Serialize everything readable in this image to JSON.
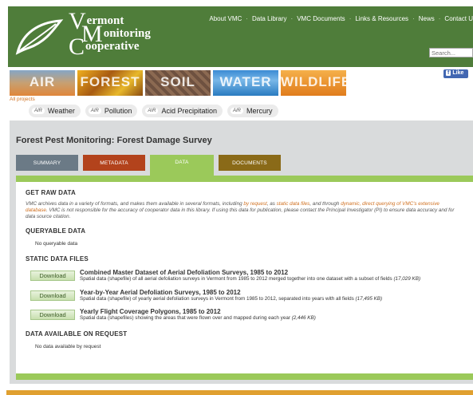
{
  "header": {
    "logo": {
      "line1": "ermont",
      "line2": "onitoring",
      "line3": "ooperative",
      "initial1": "V",
      "initial2": "M",
      "initial3": "C"
    },
    "nav": [
      {
        "label": "About VMC"
      },
      {
        "label": "Data Library"
      },
      {
        "label": "VMC Documents"
      },
      {
        "label": "Links & Resources"
      },
      {
        "label": "News"
      },
      {
        "label": "Contact U"
      }
    ],
    "nav_separator": "·",
    "search_placeholder": "Search..."
  },
  "topics": [
    {
      "label": "AIR"
    },
    {
      "label": "FOREST"
    },
    {
      "label": "SOIL"
    },
    {
      "label": "WATER"
    },
    {
      "label": "WILDLIFE"
    }
  ],
  "all_projects": "All projects",
  "facebook": {
    "f": "f",
    "label": "Like"
  },
  "subtabs": [
    {
      "badge": "AIR",
      "label": "Weather"
    },
    {
      "badge": "AIR",
      "label": "Pollution"
    },
    {
      "badge": "AIR",
      "label": "Acid Precipitation"
    },
    {
      "badge": "AIR",
      "label": "Mercury"
    }
  ],
  "page": {
    "title": "Forest Pest Monitoring: Forest Damage Survey",
    "tabs": {
      "summary": "SUMMARY",
      "metadata": "METADATA",
      "data": "DATA",
      "documents": "DOCUMENTS"
    }
  },
  "raw_data": {
    "heading": "GET RAW DATA",
    "intro_a": "VMC archives data in a variety of formats, and makes them available in several formats, including ",
    "link_request": "by request",
    "intro_b": ", as ",
    "link_static": "static data files",
    "intro_c": ", and through ",
    "link_dynamic": "dynamic, direct querying of VMC's extensive database",
    "intro_d": ". VMC is not responsible for the accuracy of cooperator data in this library. If using this data for publication, please contact the Principal Investigator (PI) to ensure data accuracy and for data source citation."
  },
  "queryable": {
    "heading": "QUERYABLE DATA",
    "text": "No queryable data"
  },
  "static_files": {
    "heading": "STATIC DATA FILES",
    "button_label": "Download",
    "files": [
      {
        "title": "Combined Master Dataset of Aerial Defoliation Surveys, 1985 to 2012",
        "desc": "Spatial data (shapefile) of all aerial defoliation surveys in Vermont from 1985 to 2012 merged together into one dataset with a subset of fields",
        "size": "(17,029 KB)"
      },
      {
        "title": "Year-by-Year Aerial Defoliation Surveys, 1985 to 2012",
        "desc": "Spatial data (shapefile) of yearly aerial defoliation surveys in Vermont from 1985 to 2012, separated into years with all fields",
        "size": "(17,495 KB)"
      },
      {
        "title": "Yearly Flight Coverage Polygons, 1985 to 2012",
        "desc": "Spatial data (shapefiles) showing the areas that were flown over and mapped during each year",
        "size": "(2,446 KB)"
      }
    ]
  },
  "on_request": {
    "heading": "DATA AVAILABLE ON REQUEST",
    "text": "No data available by request"
  },
  "colors": {
    "header_green": "#4f7d3a",
    "accent_green": "#9bc95a",
    "link_orange": "#d07020",
    "tab_summary": "#6b7a86",
    "tab_metadata": "#b3431c",
    "tab_documents": "#8a6a18"
  }
}
